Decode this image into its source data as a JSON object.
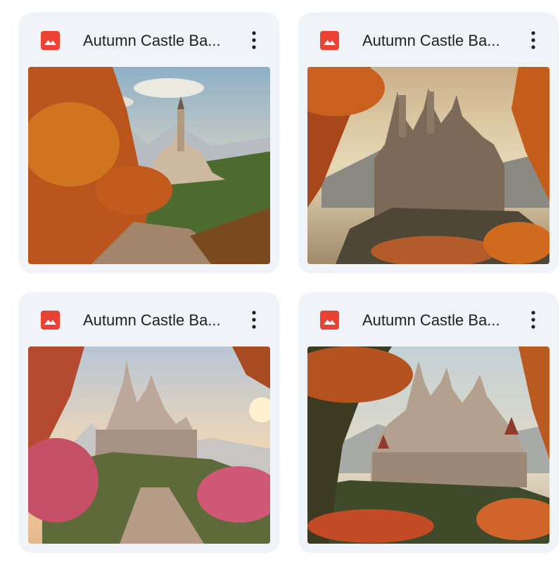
{
  "files": [
    {
      "title": "Autumn Castle Ba...",
      "type_icon": "image-file-icon",
      "menu_icon": "more-vert-icon"
    },
    {
      "title": "Autumn Castle Ba...",
      "type_icon": "image-file-icon",
      "menu_icon": "more-vert-icon"
    },
    {
      "title": "Autumn Castle Ba...",
      "type_icon": "image-file-icon",
      "menu_icon": "more-vert-icon"
    },
    {
      "title": "Autumn Castle Ba...",
      "type_icon": "image-file-icon",
      "menu_icon": "more-vert-icon"
    }
  ],
  "colors": {
    "card_bg": "#f0f4f9",
    "image_icon": "#ea4335",
    "title_text": "#1f1f1f"
  }
}
